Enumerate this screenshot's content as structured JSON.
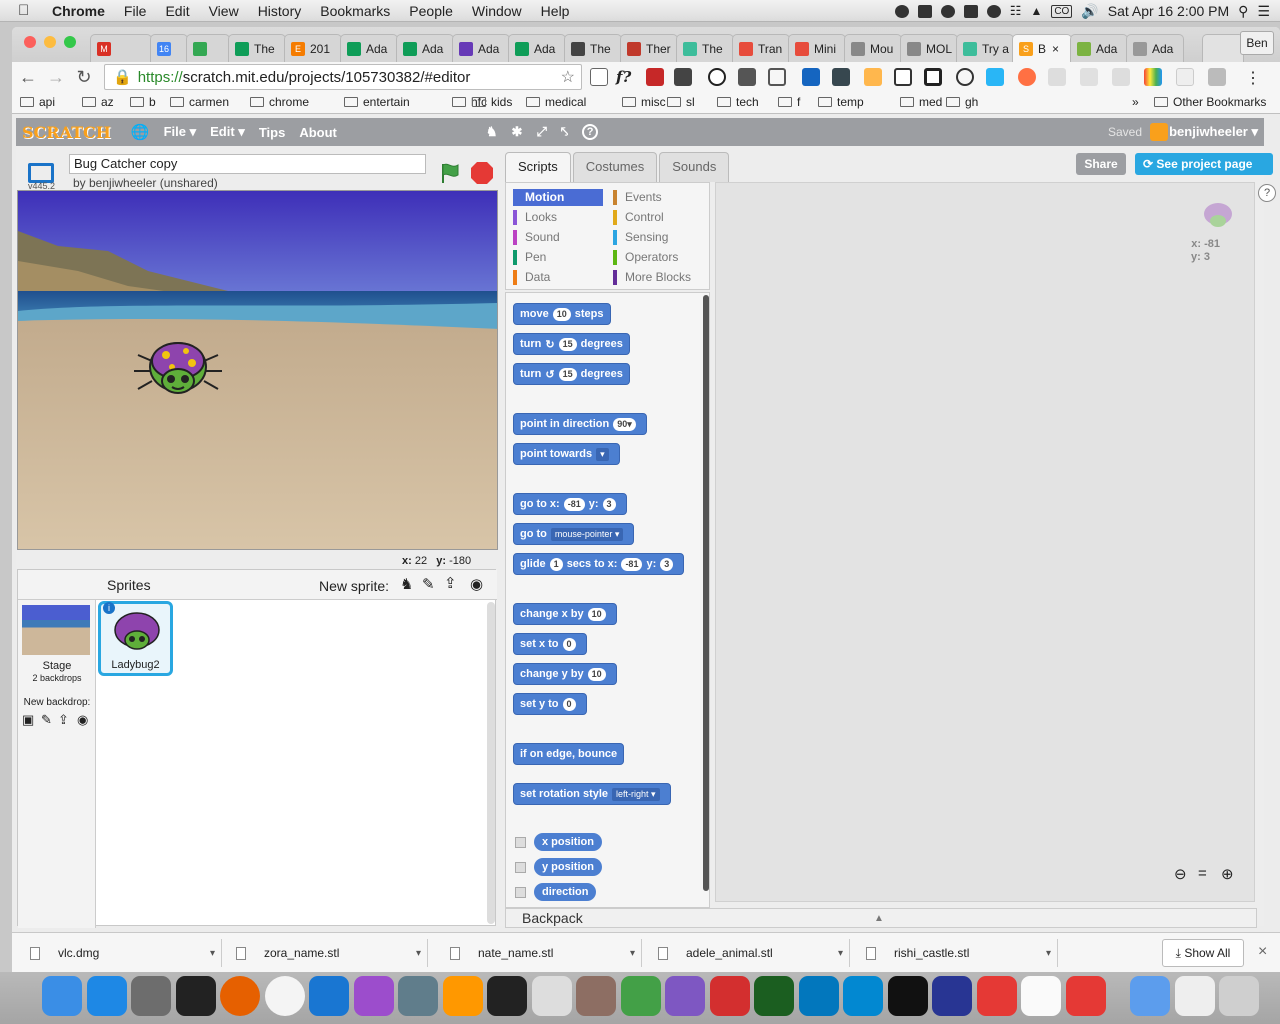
{
  "menubar": {
    "apple": "",
    "app": "Chrome",
    "menus": [
      "File",
      "Edit",
      "View",
      "History",
      "Bookmarks",
      "People",
      "Window",
      "Help"
    ],
    "clock": "Sat Apr 16  2:00 PM",
    "status_icons": [
      "dropbox-icon",
      "wifi-icon",
      "airplay-icon",
      "keyboard-co-icon",
      "volume-icon",
      "spotlight-icon",
      "list-icon"
    ],
    "co": "CO"
  },
  "browser": {
    "profile": "Ben",
    "tabs": [
      {
        "label": "",
        "color": "#d93025",
        "letter": "M"
      },
      {
        "label": "",
        "color": "#4285f4",
        "letter": "16"
      },
      {
        "label": "",
        "color": "#34a853",
        "letter": ""
      },
      {
        "label": "The",
        "color": "#0f9d58",
        "letter": ""
      },
      {
        "label": "201",
        "color": "#f57c00",
        "letter": "E"
      },
      {
        "label": "Ada",
        "color": "#0f9d58",
        "letter": ""
      },
      {
        "label": "Ada",
        "color": "#0f9d58",
        "letter": ""
      },
      {
        "label": "Ada",
        "color": "#673ab7",
        "letter": ""
      },
      {
        "label": "Ada",
        "color": "#0f9d58",
        "letter": ""
      },
      {
        "label": "The",
        "color": "#444",
        "letter": ""
      },
      {
        "label": "Ther",
        "color": "#c0392b",
        "letter": ""
      },
      {
        "label": "The",
        "color": "#3dbd9b",
        "letter": ""
      },
      {
        "label": "Tran",
        "color": "#e74c3c",
        "letter": ""
      },
      {
        "label": "Mini",
        "color": "#e74c3c",
        "letter": ""
      },
      {
        "label": "Mou",
        "color": "#888",
        "letter": ""
      },
      {
        "label": "MOL",
        "color": "#888",
        "letter": ""
      },
      {
        "label": "Try a",
        "color": "#3dbd9b",
        "letter": ""
      },
      {
        "label": "B",
        "color": "#f9a01b",
        "letter": "S",
        "active": true
      },
      {
        "label": "Ada",
        "color": "#7cb342",
        "letter": ""
      },
      {
        "label": "Ada",
        "color": "#999",
        "letter": ""
      }
    ],
    "url_secure": "https://",
    "url_rest": "scratch.mit.edu/projects/105730382/#editor",
    "bookmarks": [
      "api",
      "az",
      "b",
      "carmen",
      "chrome",
      "entertain",
      "hfc",
      "kids",
      "medical",
      "misc",
      "sl",
      "tech",
      "f",
      "temp",
      "med",
      "gh"
    ],
    "other_bookmarks": "Other Bookmarks",
    "more": "»"
  },
  "scratch": {
    "logo": "SCRATCH",
    "menu": [
      "File ▾",
      "Edit ▾",
      "Tips",
      "About"
    ],
    "saved": "Saved",
    "user": "benjiwheeler ▾",
    "share": "Share",
    "see_project": "See project page",
    "project_title": "Bug Catcher copy",
    "author": "by benjiwheeler (unshared)",
    "version": "v445.2",
    "coords_x_label": "x:",
    "coords_x": "22",
    "coords_y_label": "y:",
    "coords_y": "-180",
    "tabs": [
      "Scripts",
      "Costumes",
      "Sounds"
    ],
    "categories": [
      {
        "label": "Motion",
        "color": "#4a6cd4",
        "active": true
      },
      {
        "label": "Looks",
        "color": "#8a55d7"
      },
      {
        "label": "Sound",
        "color": "#bb42c3"
      },
      {
        "label": "Pen",
        "color": "#0e9a6c"
      },
      {
        "label": "Data",
        "color": "#ee7d16"
      },
      {
        "label": "Events",
        "color": "#c88330"
      },
      {
        "label": "Control",
        "color": "#e1a91a"
      },
      {
        "label": "Sensing",
        "color": "#2ca5e2"
      },
      {
        "label": "Operators",
        "color": "#5cb712"
      },
      {
        "label": "More Blocks",
        "color": "#632d99"
      }
    ],
    "blocks": {
      "move": "move",
      "move_val": "10",
      "steps": "steps",
      "turn": "turn",
      "turn_val": "15",
      "degrees": "degrees",
      "point_dir": "point in direction",
      "point_dir_val": "90▾",
      "point_towards": "point towards",
      "point_towards_val": "▾",
      "goto_xy": "go to x:",
      "goto_x": "-81",
      "goto_y_label": "y:",
      "goto_y": "3",
      "goto": "go to",
      "goto_val": "mouse-pointer ▾",
      "glide": "glide",
      "glide_val": "1",
      "glide_secs": "secs to x:",
      "glide_x": "-81",
      "glide_y_label": "y:",
      "glide_y": "3",
      "change_x": "change x by",
      "change_x_val": "10",
      "set_x": "set x to",
      "set_x_val": "0",
      "change_y": "change y by",
      "change_y_val": "10",
      "set_y": "set y to",
      "set_y_val": "0",
      "bounce": "if on edge, bounce",
      "rotation": "set rotation style",
      "rotation_val": "left-right ▾",
      "rep_x": "x position",
      "rep_y": "y position",
      "rep_dir": "direction"
    },
    "backpack": "Backpack",
    "sprites_label": "Sprites",
    "new_sprite": "New sprite:",
    "stage_label": "Stage",
    "stage_backdrops": "2 backdrops",
    "new_backdrop": "New backdrop:",
    "sprite_name": "Ladybug2",
    "script_sprite_x": "x: -81",
    "script_sprite_y": "y: 3"
  },
  "downloads": {
    "files": [
      "vlc.dmg",
      "zora_name.stl",
      "nate_name.stl",
      "adele_animal.stl",
      "rishi_castle.stl"
    ],
    "show_all": "Show All",
    "close": "×"
  },
  "dock": {
    "apps": [
      "finder",
      "app-store",
      "system-preferences",
      "activity-monitor",
      "firefox",
      "chrome",
      "xcode",
      "unknown-purple",
      "launchpad",
      "sublime-text",
      "terminal",
      "keyboard-maestro",
      "preview",
      "evernote",
      "emacs",
      "acrobat",
      "excel",
      "skype-s",
      "sonos-s",
      "sonos",
      "audacity",
      "photo-booth",
      "photos",
      "photo-booth-2",
      "applications",
      "documents",
      "trash"
    ]
  }
}
